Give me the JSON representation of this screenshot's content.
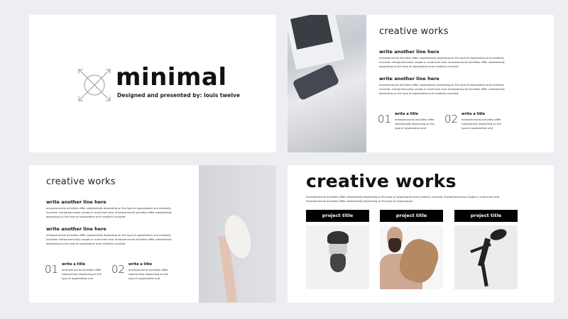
{
  "colors": {
    "background": "#eceef1",
    "slide": "#ffffff",
    "title_bar": "#000000"
  },
  "slide1": {
    "logo_icon": "crossed-arrows-circle-icon",
    "title": "minimal",
    "subtitle": "Designed and presented by: louis twelve"
  },
  "slide2": {
    "heading": "creative works",
    "sections": [
      {
        "title": "write another line here",
        "text": "entrepreneurial activities differ substantially depending on the type of organization and creativity involved. entrepreneurship ranges in scale from solo. entrepreneurial activities differ substantially depending on the type of organization and creativity involved."
      },
      {
        "title": "write another line here",
        "text": "entrepreneurial activities differ substantially depending on the type of organization and creativity involved. entrepreneurship ranges in scale from solo. entrepreneurial activities differ substantially depending on the type of organization and creativity involved."
      }
    ],
    "items": [
      {
        "number": "01",
        "title": "write a title",
        "text": "entrepreneurial activities differ substantially depending on the type of organization and"
      },
      {
        "number": "02",
        "title": "write a title",
        "text": "entrepreneurial activities differ substantially depending on the type of organization and"
      }
    ]
  },
  "slide3": {
    "heading": "creative works",
    "sections": [
      {
        "title": "write another line here",
        "text": "entrepreneurial activities differ substantially depending on the type of organization and creativity involved. entrepreneurship ranges in scale from solo. entrepreneurial activities differ substantially depending on the type of organization and creativity involved."
      },
      {
        "title": "write another line here",
        "text": "entrepreneurial activities differ substantially depending on the type of organization and creativity involved. entrepreneurship ranges in scale from solo. entrepreneurial activities differ substantially depending on the type of organization and creativity involved."
      }
    ],
    "items": [
      {
        "number": "01",
        "title": "write a title",
        "text": "entrepreneurial activities differ substantially depending on the type of organization and"
      },
      {
        "number": "02",
        "title": "write a title",
        "text": "entrepreneurial activities differ substantially depending on the type of organization and"
      }
    ]
  },
  "slide4": {
    "heading": "creative works",
    "text": "Entrepreneurial activities differ substantially depending on the type of organization and creativity involved. Entrepreneurship ranges in scale from solo. Entrepreneurial activities differ substantially depending on the type of organization.",
    "projects": [
      {
        "title": "project title"
      },
      {
        "title": "project title"
      },
      {
        "title": "project title"
      }
    ]
  }
}
